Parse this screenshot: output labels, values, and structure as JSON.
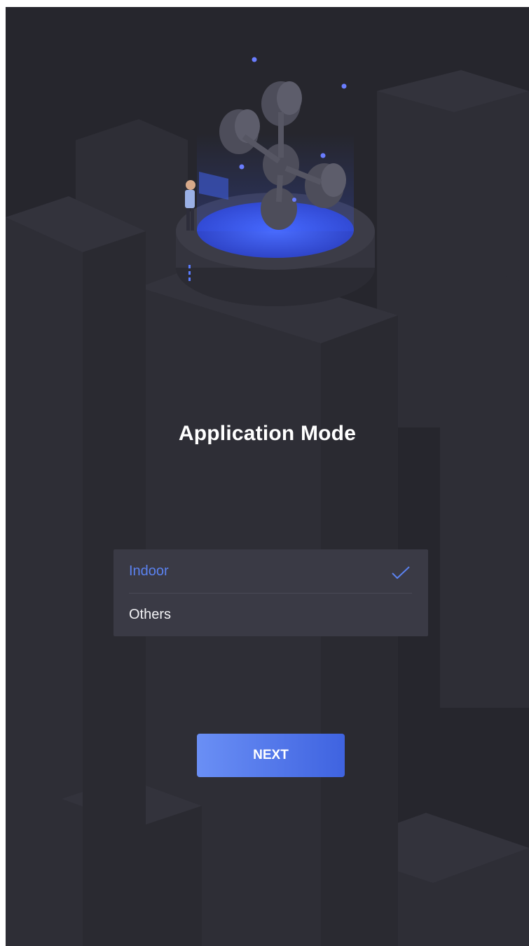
{
  "screen": {
    "title": "Application Mode",
    "options": [
      {
        "label": "Indoor",
        "selected": true
      },
      {
        "label": "Others",
        "selected": false
      }
    ],
    "selected_icon": "check-icon",
    "next_label": "NEXT"
  },
  "colors": {
    "background": "#26262d",
    "panel": "#3a3a45",
    "accent": "#5b82f0",
    "button_gradient_start": "#6a8ff5",
    "button_gradient_end": "#3f63e0",
    "text": "#ffffff"
  }
}
